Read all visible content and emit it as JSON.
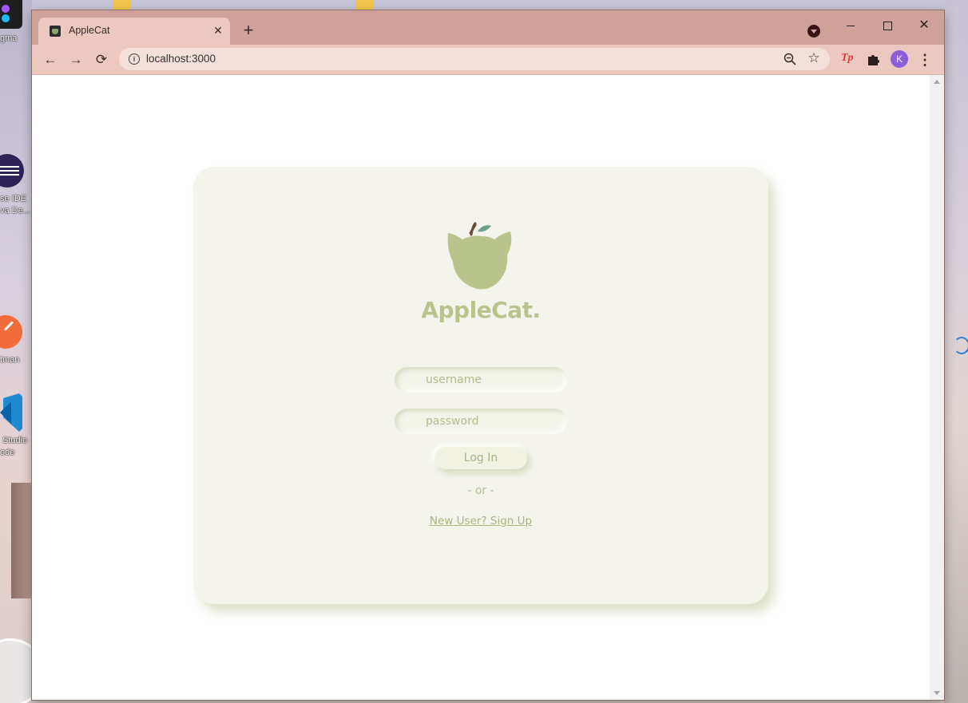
{
  "desktop": {
    "left_icons": [
      {
        "name": "figma",
        "label": "gma"
      },
      {
        "name": "eclipse",
        "label_line1": "se IDE",
        "label_line2": "va De..."
      },
      {
        "name": "postman",
        "label": "tman"
      },
      {
        "name": "vscode",
        "label_line1": "Studio",
        "label_line2": "ode"
      }
    ]
  },
  "browser": {
    "tab": {
      "title": "AppleCat",
      "close_icon": "close-icon"
    },
    "new_tab_symbol": "+",
    "window_controls": {
      "minimize": "—",
      "maximize": "☐",
      "close": "✕"
    },
    "toolbar": {
      "back": "←",
      "forward": "→",
      "reload": "⟳",
      "url": "localhost:3000",
      "extension_tp": "Tp",
      "avatar_letter": "K",
      "menu": "⋮",
      "star": "☆"
    },
    "colors": {
      "frame": "#cea199",
      "toolbar": "#ecc8c1",
      "avatar": "#8d5ed8"
    }
  },
  "page": {
    "brand": "AppleCat.",
    "username_placeholder": "username",
    "password_placeholder": "password",
    "login_label": "Log In",
    "or_text": "- or -",
    "signup_link": "New User? Sign Up",
    "colors": {
      "card": "#f4f4ec",
      "accent": "#b9c48d",
      "leaf": "#6f9e8d",
      "stem": "#6b4a3a"
    }
  }
}
